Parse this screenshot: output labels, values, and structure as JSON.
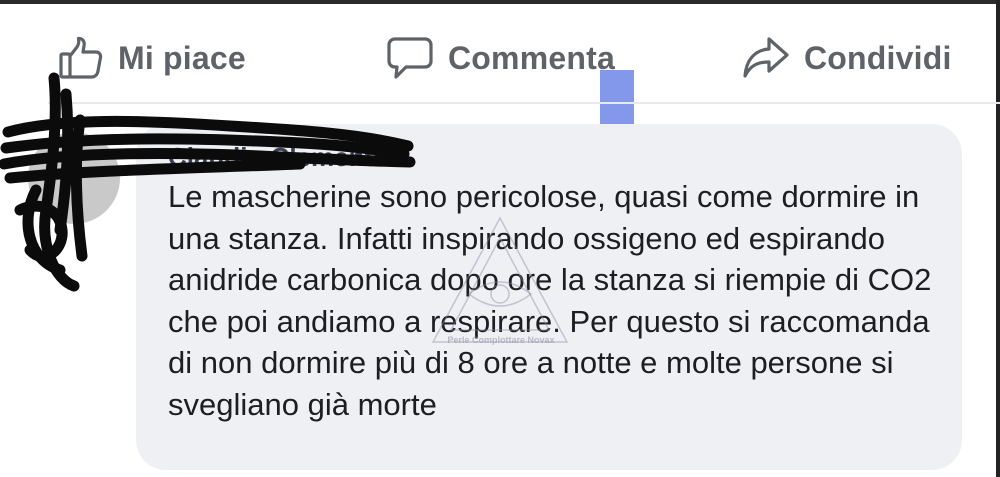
{
  "actions": {
    "like_label": "Mi piace",
    "comment_label": "Commenta",
    "share_label": "Condividi",
    "like_icon": "thumbs-up-icon",
    "comment_icon": "speech-bubble-icon",
    "share_icon": "share-arrow-icon"
  },
  "comment": {
    "author": "Claudio Clemente",
    "text": "Le mascherine sono pericolose, quasi come dormire in una stanza. Infatti inspirando ossigeno ed espirando anidride carbonica dopo ore la stanza si riempie di CO2 che poi andiamo a respirare. Per questo si raccomanda di non dormire più di 8 ore a notte e molte persone si svegliano già morte"
  },
  "watermark": {
    "text": "Perle Complottare Novax"
  },
  "colors": {
    "action_text": "#5f6368",
    "bubble_bg": "#eef0f4",
    "comment_text": "#1c1e21",
    "cursor_marker": "#6f86e8"
  }
}
